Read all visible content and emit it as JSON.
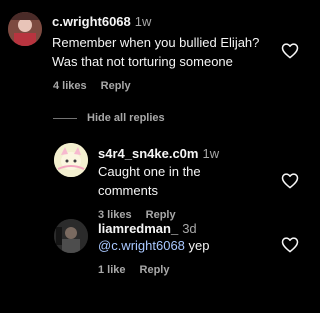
{
  "comment": {
    "username": "c.wright6068",
    "time": "1w",
    "text_line1": "Remember when you bullied Elijah?",
    "text_line2": "Was that not torturing someone",
    "likes": "4 likes",
    "reply": "Reply"
  },
  "hide_replies": "Hide all replies",
  "replies": [
    {
      "username": "s4r4_sn4ke.c0m",
      "time": "1w",
      "text_line1": "Caught one in the",
      "text_line2": "comments",
      "likes": "3 likes",
      "reply": "Reply"
    },
    {
      "username": "liamredman_",
      "time": "3d",
      "mention": "@c.wright6068",
      "text": " yep",
      "likes": "1 like",
      "reply": "Reply"
    }
  ]
}
